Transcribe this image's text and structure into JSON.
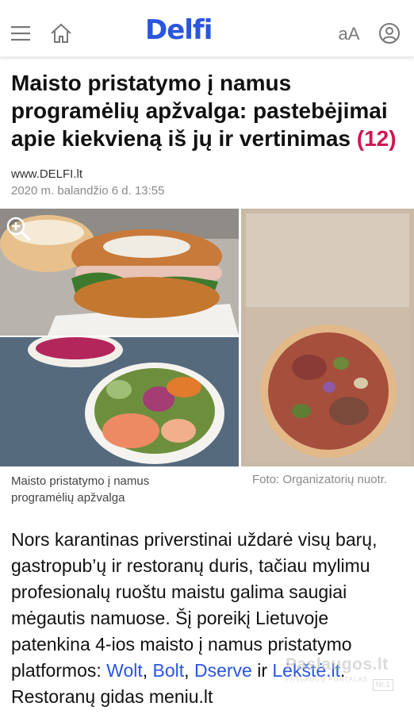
{
  "header": {
    "logo": "Delfi",
    "font_size_label": "aA"
  },
  "article": {
    "title": "Maisto pristatymo į namus programėlių apžvalga: pastebėjimai apie kiekvieną iš jų ir vertinimas",
    "comment_count": "(12)",
    "source": "www.DELFI.lt",
    "date": "2020 m. balandžio 6 d. 13:55",
    "photo_caption": "Maisto pristatymo į namus programėlių apžvalga",
    "photo_credit": "Foto: Organizatorių nuotr.",
    "body": {
      "p1_before": "Nors karantinas priverstinai uždarė visų barų, gastropub’ų ir restoranų duris, tačiau mylimu profesionalų ruoštu maistu galima saugiai mėgautis namuose. Šį poreikį Lietuvoje patenkina 4-ios maisto į namus pristatymo platformos: ",
      "link_wolt": "Wolt",
      "sep1": ", ",
      "link_bolt": "Bolt",
      "sep2": ", ",
      "link_dserve": "Dserve",
      "sep3": " ir ",
      "link_lekste": "Lėkštė.lt",
      "p1_after": ". Restoranų gidas meniu.lt"
    }
  },
  "watermark": {
    "main": "Paslaugos.lt",
    "sub": "PASLAUGŲ PORTALAS",
    "badge": "Nr.1"
  },
  "colors": {
    "brand": "#2a55e0",
    "comment": "#d0174f"
  }
}
